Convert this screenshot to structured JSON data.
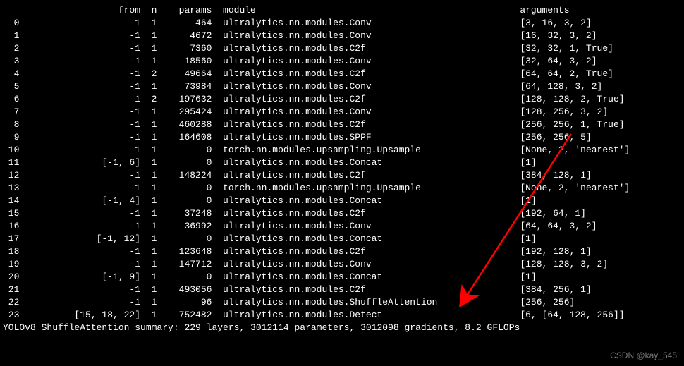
{
  "columns": {
    "idx": "",
    "from": "from",
    "n": "n",
    "params": "params",
    "module": "module",
    "arguments": "arguments"
  },
  "rows": [
    {
      "idx": "0",
      "from": "-1",
      "n": "1",
      "params": "464",
      "module": "ultralytics.nn.modules.Conv",
      "args": "[3, 16, 3, 2]"
    },
    {
      "idx": "1",
      "from": "-1",
      "n": "1",
      "params": "4672",
      "module": "ultralytics.nn.modules.Conv",
      "args": "[16, 32, 3, 2]"
    },
    {
      "idx": "2",
      "from": "-1",
      "n": "1",
      "params": "7360",
      "module": "ultralytics.nn.modules.C2f",
      "args": "[32, 32, 1, True]"
    },
    {
      "idx": "3",
      "from": "-1",
      "n": "1",
      "params": "18560",
      "module": "ultralytics.nn.modules.Conv",
      "args": "[32, 64, 3, 2]"
    },
    {
      "idx": "4",
      "from": "-1",
      "n": "2",
      "params": "49664",
      "module": "ultralytics.nn.modules.C2f",
      "args": "[64, 64, 2, True]"
    },
    {
      "idx": "5",
      "from": "-1",
      "n": "1",
      "params": "73984",
      "module": "ultralytics.nn.modules.Conv",
      "args": "[64, 128, 3, 2]"
    },
    {
      "idx": "6",
      "from": "-1",
      "n": "2",
      "params": "197632",
      "module": "ultralytics.nn.modules.C2f",
      "args": "[128, 128, 2, True]"
    },
    {
      "idx": "7",
      "from": "-1",
      "n": "1",
      "params": "295424",
      "module": "ultralytics.nn.modules.Conv",
      "args": "[128, 256, 3, 2]"
    },
    {
      "idx": "8",
      "from": "-1",
      "n": "1",
      "params": "460288",
      "module": "ultralytics.nn.modules.C2f",
      "args": "[256, 256, 1, True]"
    },
    {
      "idx": "9",
      "from": "-1",
      "n": "1",
      "params": "164608",
      "module": "ultralytics.nn.modules.SPPF",
      "args": "[256, 256, 5]"
    },
    {
      "idx": "10",
      "from": "-1",
      "n": "1",
      "params": "0",
      "module": "torch.nn.modules.upsampling.Upsample",
      "args": "[None, 2, 'nearest']"
    },
    {
      "idx": "11",
      "from": "[-1, 6]",
      "n": "1",
      "params": "0",
      "module": "ultralytics.nn.modules.Concat",
      "args": "[1]"
    },
    {
      "idx": "12",
      "from": "-1",
      "n": "1",
      "params": "148224",
      "module": "ultralytics.nn.modules.C2f",
      "args": "[384, 128, 1]"
    },
    {
      "idx": "13",
      "from": "-1",
      "n": "1",
      "params": "0",
      "module": "torch.nn.modules.upsampling.Upsample",
      "args": "[None, 2, 'nearest']"
    },
    {
      "idx": "14",
      "from": "[-1, 4]",
      "n": "1",
      "params": "0",
      "module": "ultralytics.nn.modules.Concat",
      "args": "[1]"
    },
    {
      "idx": "15",
      "from": "-1",
      "n": "1",
      "params": "37248",
      "module": "ultralytics.nn.modules.C2f",
      "args": "[192, 64, 1]"
    },
    {
      "idx": "16",
      "from": "-1",
      "n": "1",
      "params": "36992",
      "module": "ultralytics.nn.modules.Conv",
      "args": "[64, 64, 3, 2]"
    },
    {
      "idx": "17",
      "from": "[-1, 12]",
      "n": "1",
      "params": "0",
      "module": "ultralytics.nn.modules.Concat",
      "args": "[1]"
    },
    {
      "idx": "18",
      "from": "-1",
      "n": "1",
      "params": "123648",
      "module": "ultralytics.nn.modules.C2f",
      "args": "[192, 128, 1]"
    },
    {
      "idx": "19",
      "from": "-1",
      "n": "1",
      "params": "147712",
      "module": "ultralytics.nn.modules.Conv",
      "args": "[128, 128, 3, 2]"
    },
    {
      "idx": "20",
      "from": "[-1, 9]",
      "n": "1",
      "params": "0",
      "module": "ultralytics.nn.modules.Concat",
      "args": "[1]"
    },
    {
      "idx": "21",
      "from": "-1",
      "n": "1",
      "params": "493056",
      "module": "ultralytics.nn.modules.C2f",
      "args": "[384, 256, 1]"
    },
    {
      "idx": "22",
      "from": "-1",
      "n": "1",
      "params": "96",
      "module": "ultralytics.nn.modules.ShuffleAttention",
      "args": "[256, 256]"
    },
    {
      "idx": "23",
      "from": "[15, 18, 22]",
      "n": "1",
      "params": "752482",
      "module": "ultralytics.nn.modules.Detect",
      "args": "[6, [64, 128, 256]]"
    }
  ],
  "summary": "YOLOv8_ShuffleAttention summary: 229 layers, 3012114 parameters, 3012098 gradients, 8.2 GFLOPs",
  "watermark": "CSDN @kay_545",
  "arrow_color": "#ff0000"
}
